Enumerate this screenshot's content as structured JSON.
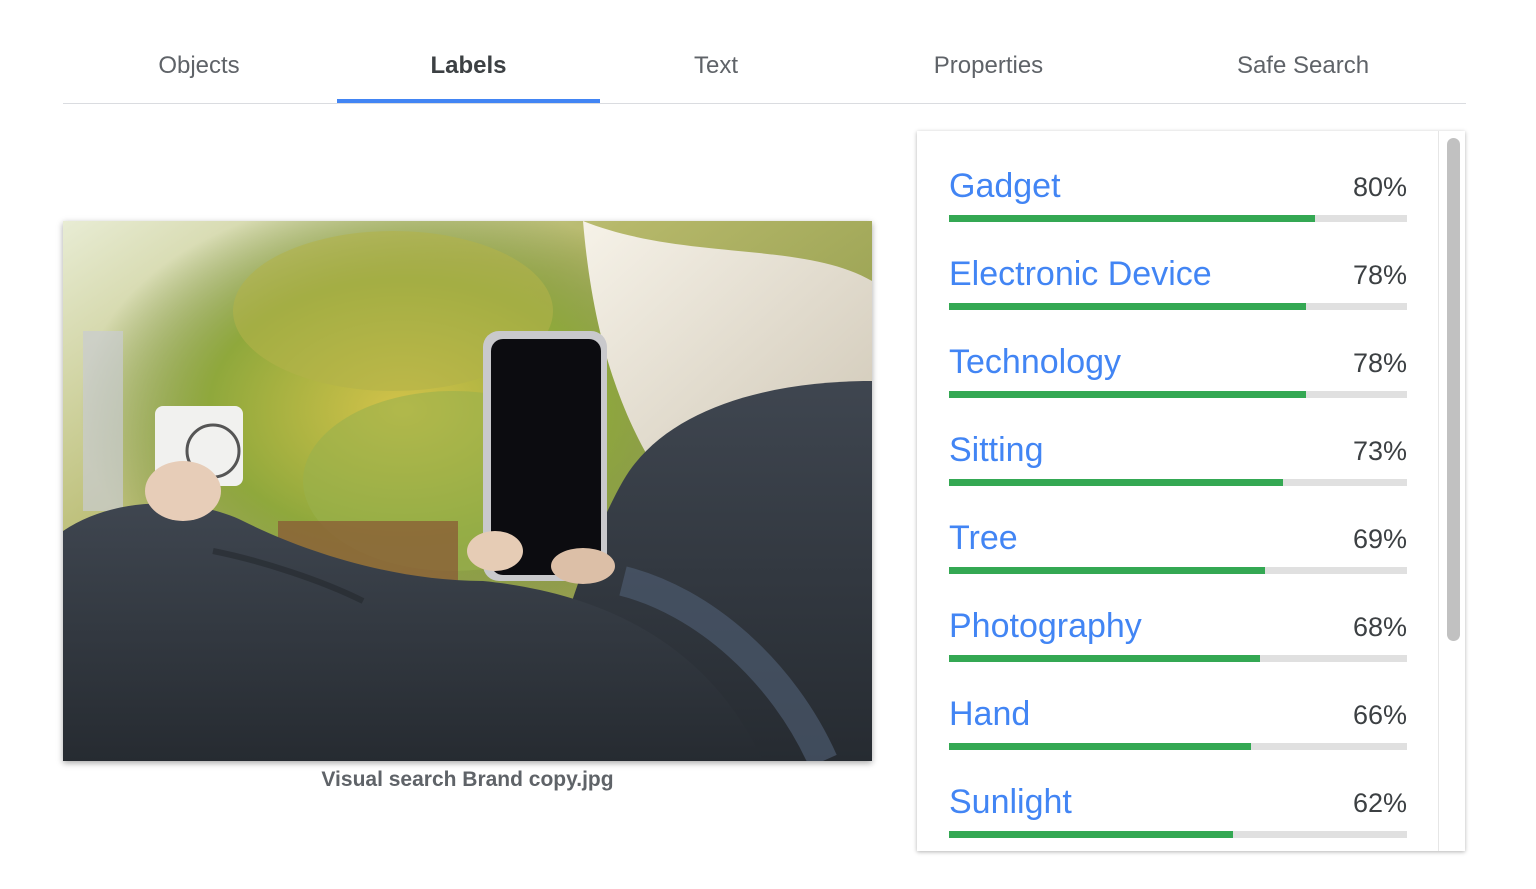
{
  "tabs": [
    {
      "label": "Objects",
      "active": false
    },
    {
      "label": "Labels",
      "active": true
    },
    {
      "label": "Text",
      "active": false
    },
    {
      "label": "Properties",
      "active": false
    },
    {
      "label": "Safe Search",
      "active": false
    }
  ],
  "image": {
    "caption": "Visual search Brand copy.jpg"
  },
  "labels": [
    {
      "name": "Gadget",
      "score": "80%",
      "value": 0.8
    },
    {
      "name": "Electronic Device",
      "score": "78%",
      "value": 0.78
    },
    {
      "name": "Technology",
      "score": "78%",
      "value": 0.78
    },
    {
      "name": "Sitting",
      "score": "73%",
      "value": 0.73
    },
    {
      "name": "Tree",
      "score": "69%",
      "value": 0.69
    },
    {
      "name": "Photography",
      "score": "68%",
      "value": 0.68
    },
    {
      "name": "Hand",
      "score": "66%",
      "value": 0.66
    },
    {
      "name": "Sunlight",
      "score": "62%",
      "value": 0.62
    }
  ],
  "colors": {
    "accent": "#4285f4",
    "bar_fill": "#34a853",
    "bar_track": "#e0e0e0"
  }
}
